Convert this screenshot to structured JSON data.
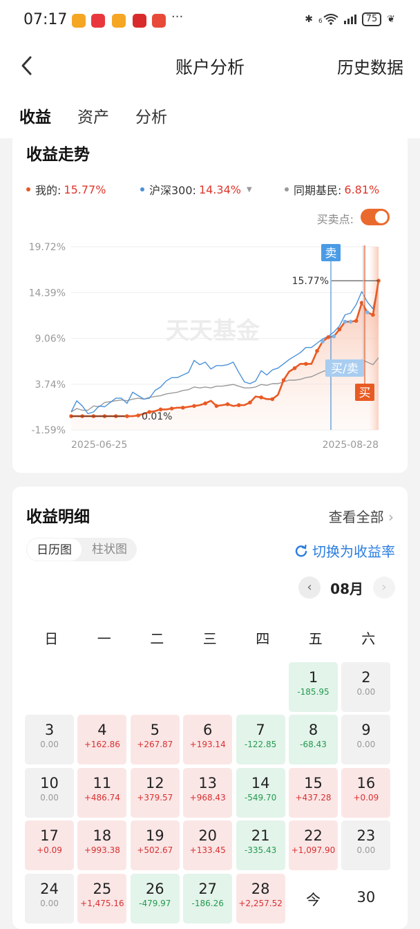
{
  "status": {
    "time": "07:17",
    "dots": "···",
    "battery": "75",
    "wifi": "6"
  },
  "header": {
    "title": "账户分析",
    "right": "历史数据"
  },
  "tabs": [
    "收益",
    "资产",
    "分析"
  ],
  "trend": {
    "title": "收益走势",
    "legend": [
      {
        "name": "我的:",
        "value": "15.77%",
        "color": "#e85a24"
      },
      {
        "name": "沪深300:",
        "value": "14.34%",
        "color": "#4a90d9"
      },
      {
        "name": "同期基民:",
        "value": "6.81%",
        "color": "#999999"
      }
    ],
    "buy_sell_label": "买卖点:",
    "watermark": "天天基金"
  },
  "chart_data": {
    "type": "line",
    "yticks": [
      "19.72%",
      "14.39%",
      "9.06%",
      "3.74%",
      "-1.59%"
    ],
    "ylim": [
      -1.59,
      19.72
    ],
    "x_start": "2025-06-25",
    "x_end": "2025-08-28",
    "annotations": {
      "end_value": "15.77%",
      "start_value": "0.01%",
      "sell": "卖",
      "buy_sell": "买/卖",
      "buy": "买"
    },
    "series": [
      {
        "name": "我的",
        "color": "#e85a24",
        "values": [
          0.01,
          0.01,
          0.01,
          0.01,
          0.01,
          0.01,
          0.01,
          0.01,
          0.01,
          0.01,
          0.01,
          0.01,
          0.1,
          0.3,
          0.5,
          0.6,
          0.8,
          0.8,
          0.9,
          1.0,
          1.0,
          1.1,
          1.2,
          1.3,
          1.5,
          1.8,
          1.2,
          1.3,
          1.4,
          1.2,
          1.3,
          1.3,
          1.6,
          2.3,
          2.2,
          2.0,
          2.0,
          2.5,
          4.2,
          5.2,
          5.6,
          6.1,
          6.1,
          6.1,
          7.6,
          8.7,
          9.2,
          9.3,
          10.1,
          11.0,
          11.0,
          11.1,
          13.2,
          12.1,
          11.8,
          15.77
        ]
      },
      {
        "name": "沪深300",
        "color": "#4a90d9",
        "values": [
          0.5,
          1.8,
          1.2,
          0.3,
          0.5,
          1.2,
          1.1,
          1.6,
          2.1,
          2.1,
          1.5,
          2.8,
          2.4,
          2.0,
          2.1,
          3.0,
          3.4,
          4.1,
          4.5,
          4.5,
          4.8,
          5.1,
          6.5,
          6.0,
          6.3,
          5.5,
          5.9,
          5.9,
          6.0,
          6.3,
          5.1,
          4.0,
          3.8,
          4.1,
          5.3,
          4.8,
          5.4,
          5.6,
          6.1,
          6.6,
          7.0,
          7.4,
          8.0,
          8.0,
          8.5,
          9.0,
          9.3,
          9.8,
          10.5,
          11.8,
          12.0,
          13.0,
          14.5,
          13.3,
          12.5,
          15.5
        ]
      },
      {
        "name": "同期基民",
        "color": "#999999",
        "values": [
          0.5,
          0.9,
          0.7,
          0.7,
          1.2,
          1.1,
          1.6,
          1.7,
          1.8,
          1.9,
          1.8,
          2.0,
          2.1,
          2.0,
          2.2,
          2.3,
          2.4,
          2.6,
          2.7,
          2.8,
          3.0,
          3.1,
          3.4,
          3.3,
          3.4,
          3.3,
          3.5,
          3.5,
          3.6,
          3.7,
          3.5,
          3.3,
          3.3,
          3.4,
          3.7,
          3.6,
          3.8,
          3.8,
          4.0,
          4.2,
          4.2,
          4.3,
          4.5,
          4.6,
          4.9,
          5.2,
          5.4,
          5.5,
          5.6,
          5.7,
          6.0,
          6.1,
          6.6,
          6.3,
          6.0,
          6.81
        ]
      }
    ]
  },
  "detail": {
    "title": "收益明细",
    "view_all": "查看全部",
    "seg": [
      "日历图",
      "柱状图"
    ],
    "switch": "切换为收益率",
    "month": "08月",
    "weekdays": [
      "日",
      "一",
      "二",
      "三",
      "四",
      "五",
      "六"
    ],
    "days": [
      {
        "d": "1",
        "v": "-185.95",
        "t": "neg",
        "col": 5,
        "row": 0
      },
      {
        "d": "2",
        "v": "0.00",
        "t": "zero",
        "col": 6,
        "row": 0
      },
      {
        "d": "3",
        "v": "0.00",
        "t": "zero",
        "col": 0,
        "row": 1
      },
      {
        "d": "4",
        "v": "+162.86",
        "t": "pos",
        "col": 1,
        "row": 1
      },
      {
        "d": "5",
        "v": "+267.87",
        "t": "pos",
        "col": 2,
        "row": 1
      },
      {
        "d": "6",
        "v": "+193.14",
        "t": "pos",
        "col": 3,
        "row": 1
      },
      {
        "d": "7",
        "v": "-122.85",
        "t": "neg",
        "col": 4,
        "row": 1
      },
      {
        "d": "8",
        "v": "-68.43",
        "t": "neg",
        "col": 5,
        "row": 1
      },
      {
        "d": "9",
        "v": "0.00",
        "t": "zero",
        "col": 6,
        "row": 1
      },
      {
        "d": "10",
        "v": "0.00",
        "t": "zero",
        "col": 0,
        "row": 2
      },
      {
        "d": "11",
        "v": "+486.74",
        "t": "pos",
        "col": 1,
        "row": 2
      },
      {
        "d": "12",
        "v": "+379.57",
        "t": "pos",
        "col": 2,
        "row": 2
      },
      {
        "d": "13",
        "v": "+968.43",
        "t": "pos",
        "col": 3,
        "row": 2
      },
      {
        "d": "14",
        "v": "-549.70",
        "t": "neg",
        "col": 4,
        "row": 2
      },
      {
        "d": "15",
        "v": "+437.28",
        "t": "pos",
        "col": 5,
        "row": 2
      },
      {
        "d": "16",
        "v": "+0.09",
        "t": "pos",
        "col": 6,
        "row": 2
      },
      {
        "d": "17",
        "v": "+0.09",
        "t": "pos",
        "col": 0,
        "row": 3
      },
      {
        "d": "18",
        "v": "+993.38",
        "t": "pos",
        "col": 1,
        "row": 3
      },
      {
        "d": "19",
        "v": "+502.67",
        "t": "pos",
        "col": 2,
        "row": 3
      },
      {
        "d": "20",
        "v": "+133.45",
        "t": "pos",
        "col": 3,
        "row": 3
      },
      {
        "d": "21",
        "v": "-335.43",
        "t": "neg",
        "col": 4,
        "row": 3
      },
      {
        "d": "22",
        "v": "+1,097.90",
        "t": "pos",
        "col": 5,
        "row": 3
      },
      {
        "d": "23",
        "v": "0.00",
        "t": "zero",
        "col": 6,
        "row": 3
      },
      {
        "d": "24",
        "v": "0.00",
        "t": "zero",
        "col": 0,
        "row": 4
      },
      {
        "d": "25",
        "v": "+1,475.16",
        "t": "pos",
        "col": 1,
        "row": 4
      },
      {
        "d": "26",
        "v": "-479.97",
        "t": "neg",
        "col": 2,
        "row": 4
      },
      {
        "d": "27",
        "v": "-186.26",
        "t": "neg",
        "col": 3,
        "row": 4
      },
      {
        "d": "28",
        "v": "+2,257.52",
        "t": "pos",
        "col": 4,
        "row": 4
      },
      {
        "d": "今",
        "v": "",
        "t": "plain",
        "col": 5,
        "row": 4
      },
      {
        "d": "30",
        "v": "",
        "t": "plain",
        "col": 6,
        "row": 4
      }
    ]
  }
}
